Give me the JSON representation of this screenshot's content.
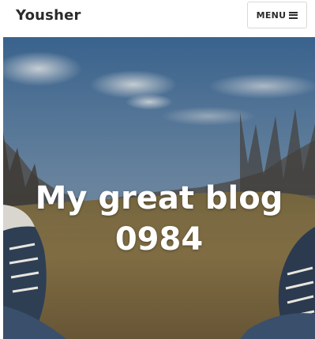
{
  "header": {
    "site_title": "Yousher",
    "menu_label": "MENU"
  },
  "hero": {
    "title_line1": "My great blog",
    "title_line2": "0984"
  },
  "icons": {
    "menu": "hamburger-icon"
  }
}
